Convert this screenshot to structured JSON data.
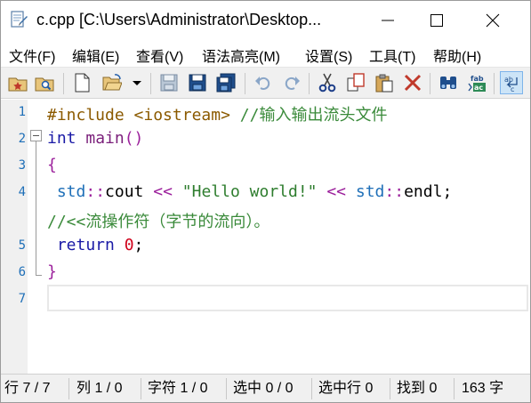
{
  "window": {
    "title": "c.cpp [C:\\Users\\Administrator\\Desktop..."
  },
  "menu": [
    {
      "label": "文件(F)"
    },
    {
      "label": "编辑(E)"
    },
    {
      "label": "查看(V)"
    },
    {
      "label": "语法高亮(M)"
    },
    {
      "label": "设置(S)"
    },
    {
      "label": "工具(T)"
    },
    {
      "label": "帮助(H)"
    }
  ],
  "toolbar": [
    {
      "icon": "favorites-folder-icon"
    },
    {
      "icon": "find-folder-icon"
    },
    {
      "icon": "new-file-icon"
    },
    {
      "icon": "open-folder-icon"
    },
    {
      "icon": "dropdown-arrow-icon"
    },
    {
      "icon": "save-icon"
    },
    {
      "icon": "save-as-icon"
    },
    {
      "icon": "save-all-icon"
    },
    {
      "icon": "undo-icon"
    },
    {
      "icon": "redo-icon"
    },
    {
      "icon": "cut-icon"
    },
    {
      "icon": "copy-icon"
    },
    {
      "icon": "paste-icon"
    },
    {
      "icon": "delete-icon"
    },
    {
      "icon": "find-icon"
    },
    {
      "icon": "replace-icon"
    },
    {
      "icon": "word-wrap-icon"
    }
  ],
  "editor": {
    "line_numbers": [
      "1",
      "2",
      "3",
      "4",
      "5",
      "6",
      "7"
    ],
    "lines": [
      {
        "tokens": [
          {
            "t": "#include",
            "c": "pre"
          },
          {
            "t": " ",
            "c": "plain"
          },
          {
            "t": "<iostream>",
            "c": "inc"
          },
          {
            "t": " ",
            "c": "plain"
          },
          {
            "t": "//输入输出流头文件",
            "c": "com"
          }
        ]
      },
      {
        "tokens": [
          {
            "t": "int",
            "c": "kw"
          },
          {
            "t": " ",
            "c": "plain"
          },
          {
            "t": "main",
            "c": "fn"
          },
          {
            "t": "()",
            "c": "br"
          }
        ]
      },
      {
        "tokens": [
          {
            "t": "{",
            "c": "br"
          }
        ]
      },
      {
        "tokens": [
          {
            "t": " std",
            "c": "ns"
          },
          {
            "t": "::",
            "c": "op"
          },
          {
            "t": "cout",
            "c": "plain"
          },
          {
            "t": " ",
            "c": "plain"
          },
          {
            "t": "<<",
            "c": "op"
          },
          {
            "t": " ",
            "c": "plain"
          },
          {
            "t": "\"Hello world!\"",
            "c": "str"
          },
          {
            "t": " ",
            "c": "plain"
          },
          {
            "t": "<<",
            "c": "op"
          },
          {
            "t": " ",
            "c": "plain"
          },
          {
            "t": "std",
            "c": "ns"
          },
          {
            "t": "::",
            "c": "op"
          },
          {
            "t": "endl",
            "c": "plain"
          },
          {
            "t": ";",
            "c": "plain"
          }
        ]
      },
      {
        "tokens": [
          {
            "t": "//<<流操作符（字节的流向）。",
            "c": "com"
          }
        ]
      },
      {
        "tokens": [
          {
            "t": " return",
            "c": "kw"
          },
          {
            "t": " ",
            "c": "plain"
          },
          {
            "t": "0",
            "c": "num"
          },
          {
            "t": ";",
            "c": "plain"
          }
        ]
      },
      {
        "tokens": [
          {
            "t": "}",
            "c": "br"
          }
        ]
      },
      {
        "tokens": []
      }
    ]
  },
  "status": [
    {
      "label": "行 7 / 7"
    },
    {
      "label": "列 1 / 0"
    },
    {
      "label": "字符 1 / 0"
    },
    {
      "label": "选中 0 / 0"
    },
    {
      "label": "选中行 0"
    },
    {
      "label": "找到 0"
    },
    {
      "label": "163 字"
    }
  ]
}
